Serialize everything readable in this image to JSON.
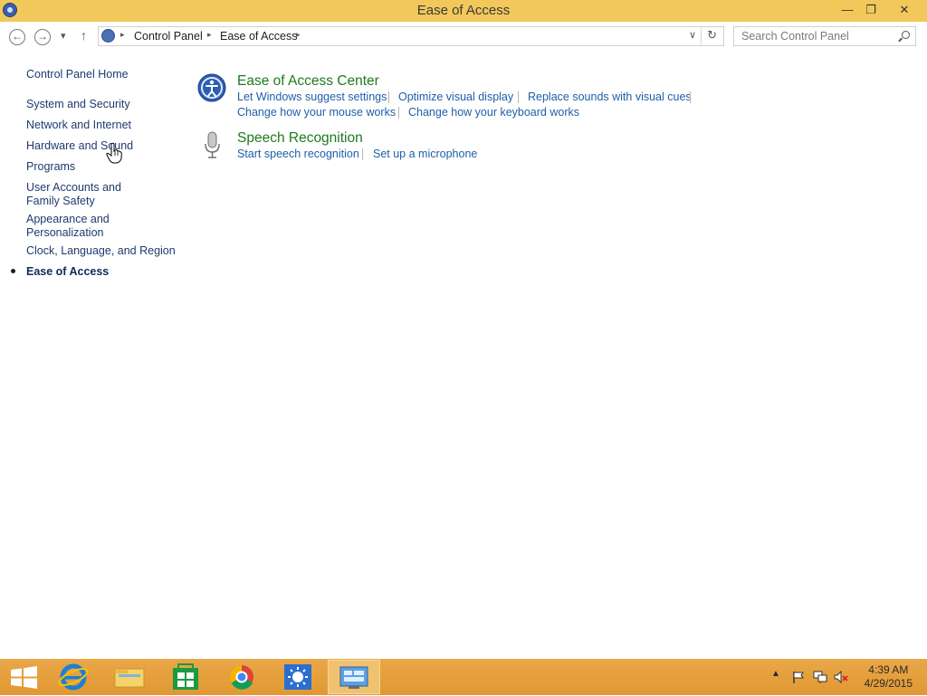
{
  "window": {
    "title": "Ease of Access",
    "minimize_glyph": "—",
    "restore_glyph": "❐",
    "close_glyph": "✕"
  },
  "nav": {
    "back_glyph": "←",
    "forward_glyph": "→",
    "recent_glyph": "▾",
    "up_glyph": "↑",
    "breadcrumb": [
      "Control Panel",
      "Ease of Access"
    ],
    "dropdown_glyph": "∨",
    "refresh_glyph": "↻",
    "search_placeholder": "Search Control Panel"
  },
  "sidebar": {
    "home": "Control Panel Home",
    "items": [
      "System and Security",
      "Network and Internet",
      "Hardware and Sound",
      "Programs",
      "User Accounts and Family Safety",
      "Appearance and Personalization",
      "Clock, Language, and Region",
      "Ease of Access"
    ],
    "current_index": 7
  },
  "categories": [
    {
      "title": "Ease of Access Center",
      "icon": "ease-of-access-center-icon",
      "links": [
        "Let Windows suggest settings",
        "Optimize visual display",
        "Replace sounds with visual cues",
        "Change how your mouse works",
        "Change how your keyboard works"
      ]
    },
    {
      "title": "Speech Recognition",
      "icon": "microphone-icon",
      "links": [
        "Start speech recognition",
        "Set up a microphone"
      ]
    }
  ],
  "taskbar": {
    "apps": [
      "start-icon",
      "internet-explorer-icon",
      "file-explorer-icon",
      "store-icon",
      "chrome-icon",
      "settings-app-icon",
      "control-panel-icon"
    ],
    "active_app": "control-panel-icon",
    "clock_time": "4:39 AM",
    "clock_date": "4/29/2015"
  },
  "colors": {
    "titlebar": "#f2c85a",
    "taskbar": "#e6a23a",
    "category_title": "#1f7a1f",
    "link": "#1e5fa8"
  }
}
